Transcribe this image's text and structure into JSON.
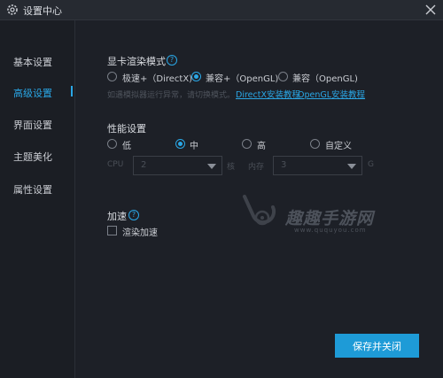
{
  "window": {
    "title": "设置中心"
  },
  "sidebar": {
    "items": [
      {
        "label": "基本设置"
      },
      {
        "label": "高级设置"
      },
      {
        "label": "界面设置"
      },
      {
        "label": "主题美化"
      },
      {
        "label": "属性设置"
      }
    ],
    "active_index": 1
  },
  "render_mode": {
    "heading": "显卡渲染模式",
    "options": [
      "极速+（DirectX)",
      "兼容+（OpenGL)",
      "兼容（OpenGL)"
    ],
    "selected_index": 1,
    "note": "如遇模拟器运行异常，请切换模式。",
    "links": [
      "DirectX安装教程",
      "OpenGL安装教程"
    ]
  },
  "performance": {
    "heading": "性能设置",
    "options": [
      "低",
      "中",
      "高",
      "自定义"
    ],
    "selected_index": 1,
    "cpu_label": "CPU",
    "cpu_value": "2",
    "cpu_unit": "核",
    "memory_label": "内存",
    "memory_value": "3",
    "memory_unit": "G"
  },
  "acceleration": {
    "heading": "加速",
    "checkbox_label": "渲染加速",
    "checked": false
  },
  "watermark": {
    "text": "趣趣手游网",
    "sub": "www.ququyou.com"
  },
  "footer": {
    "save_label": "保存并关闭"
  },
  "colors": {
    "accent": "#2aa7e6",
    "background": "#1d2027",
    "button": "#1e9bd7"
  },
  "icons": [
    "gear-icon",
    "close-icon",
    "help-icon",
    "dropdown-arrow-icon",
    "watermark-logo-icon"
  ]
}
